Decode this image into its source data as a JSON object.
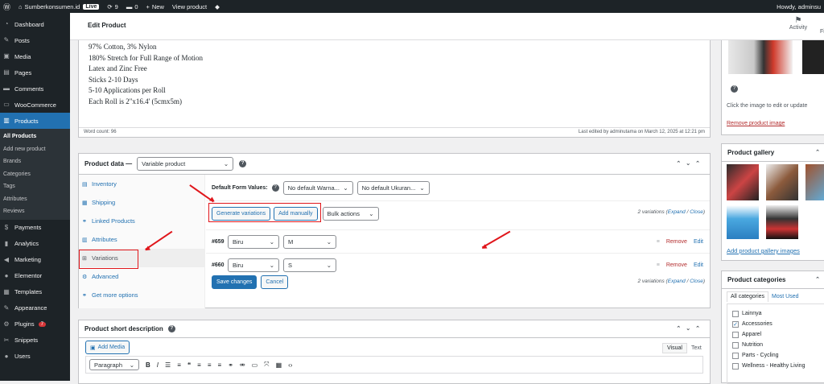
{
  "admin_bar": {
    "site": "Sumberkonsumen.id",
    "live": "Live",
    "updates": "9",
    "comments": "0",
    "new": "New",
    "view": "View product",
    "howdy": "Howdy, adminsu"
  },
  "sidebar": {
    "items": [
      {
        "label": "Dashboard",
        "icon": "dashboard-icon",
        "glyph": "◔"
      },
      {
        "label": "Posts",
        "icon": "pin-icon",
        "glyph": "✎"
      },
      {
        "label": "Media",
        "icon": "media-icon",
        "glyph": "▣"
      },
      {
        "label": "Pages",
        "icon": "page-icon",
        "glyph": "▤"
      },
      {
        "label": "Comments",
        "icon": "comment-icon",
        "glyph": "▬"
      },
      {
        "label": "WooCommerce",
        "icon": "woo-icon",
        "glyph": "▭"
      },
      {
        "label": "Products",
        "icon": "products-icon",
        "glyph": "▥"
      }
    ],
    "submenu": [
      "All Products",
      "Add new product",
      "Brands",
      "Categories",
      "Tags",
      "Attributes",
      "Reviews"
    ],
    "items2": [
      {
        "label": "Payments",
        "icon": "payments-icon",
        "glyph": "$"
      },
      {
        "label": "Analytics",
        "icon": "analytics-icon",
        "glyph": "▮"
      },
      {
        "label": "Marketing",
        "icon": "marketing-icon",
        "glyph": "◀"
      },
      {
        "label": "Elementor",
        "icon": "elementor-icon",
        "glyph": "●"
      },
      {
        "label": "Templates",
        "icon": "templates-icon",
        "glyph": "▦"
      },
      {
        "label": "Appearance",
        "icon": "appearance-icon",
        "glyph": "✎"
      },
      {
        "label": "Plugins",
        "icon": "plugins-icon",
        "glyph": "⚙",
        "badge": "7"
      },
      {
        "label": "Snippets",
        "icon": "snippets-icon",
        "glyph": "✂"
      },
      {
        "label": "Users",
        "icon": "users-icon",
        "glyph": "●"
      }
    ]
  },
  "header": {
    "title": "Edit Product",
    "activity": "Activity",
    "fi": "Fi"
  },
  "description": {
    "lines": [
      "97% Cotton, 3% Nylon",
      "180% Stretch for Full Range of Motion",
      "Latex and Zinc Free",
      "Sticks 2-10 Days",
      "5-10 Applications per Roll",
      "Each Roll is 2\"x16.4' (5cmx5m)"
    ],
    "word_count": "Word count: 96",
    "last_edited": "Last edited by adminutama on March 12, 2025 at 12:21 pm"
  },
  "product_data": {
    "title": "Product data —",
    "type": "Variable product",
    "help": "?",
    "tabs": [
      "Inventory",
      "Shipping",
      "Linked Products",
      "Attributes",
      "Variations",
      "Advanced",
      "Get more options"
    ],
    "default_label": "Default Form Values:",
    "default1": "No default Warna...",
    "default2": "No default Ukuran...",
    "generate": "Generate variations",
    "add_manually": "Add manually",
    "bulk": "Bulk actions",
    "count": "2 variations (",
    "expand": "Expand",
    "slash": " / ",
    "close": "Close",
    "count_end": ")",
    "variations": [
      {
        "id": "#659",
        "color": "Biru",
        "size": "M"
      },
      {
        "id": "#660",
        "color": "Biru",
        "size": "S"
      }
    ],
    "remove": "Remove",
    "edit": "Edit",
    "save": "Save changes",
    "cancel": "Cancel"
  },
  "short_desc": {
    "title": "Product short description",
    "add_media": "Add Media",
    "visual": "Visual",
    "text": "Text",
    "paragraph": "Paragraph"
  },
  "image_box": {
    "hint": "Click the image to edit or update",
    "remove": "Remove product image"
  },
  "gallery": {
    "title": "Product gallery",
    "add": "Add product gallery images"
  },
  "categories": {
    "title": "Product categories",
    "tab_all": "All categories",
    "tab_most": "Most Used",
    "items": [
      {
        "label": "Lainnya",
        "checked": false
      },
      {
        "label": "Accessories",
        "checked": true
      },
      {
        "label": "Apparel",
        "checked": false
      },
      {
        "label": "Nutrition",
        "checked": false
      },
      {
        "label": "Parts - Cycling",
        "checked": false
      },
      {
        "label": "Wellness - Healthy Living",
        "checked": false
      }
    ]
  }
}
